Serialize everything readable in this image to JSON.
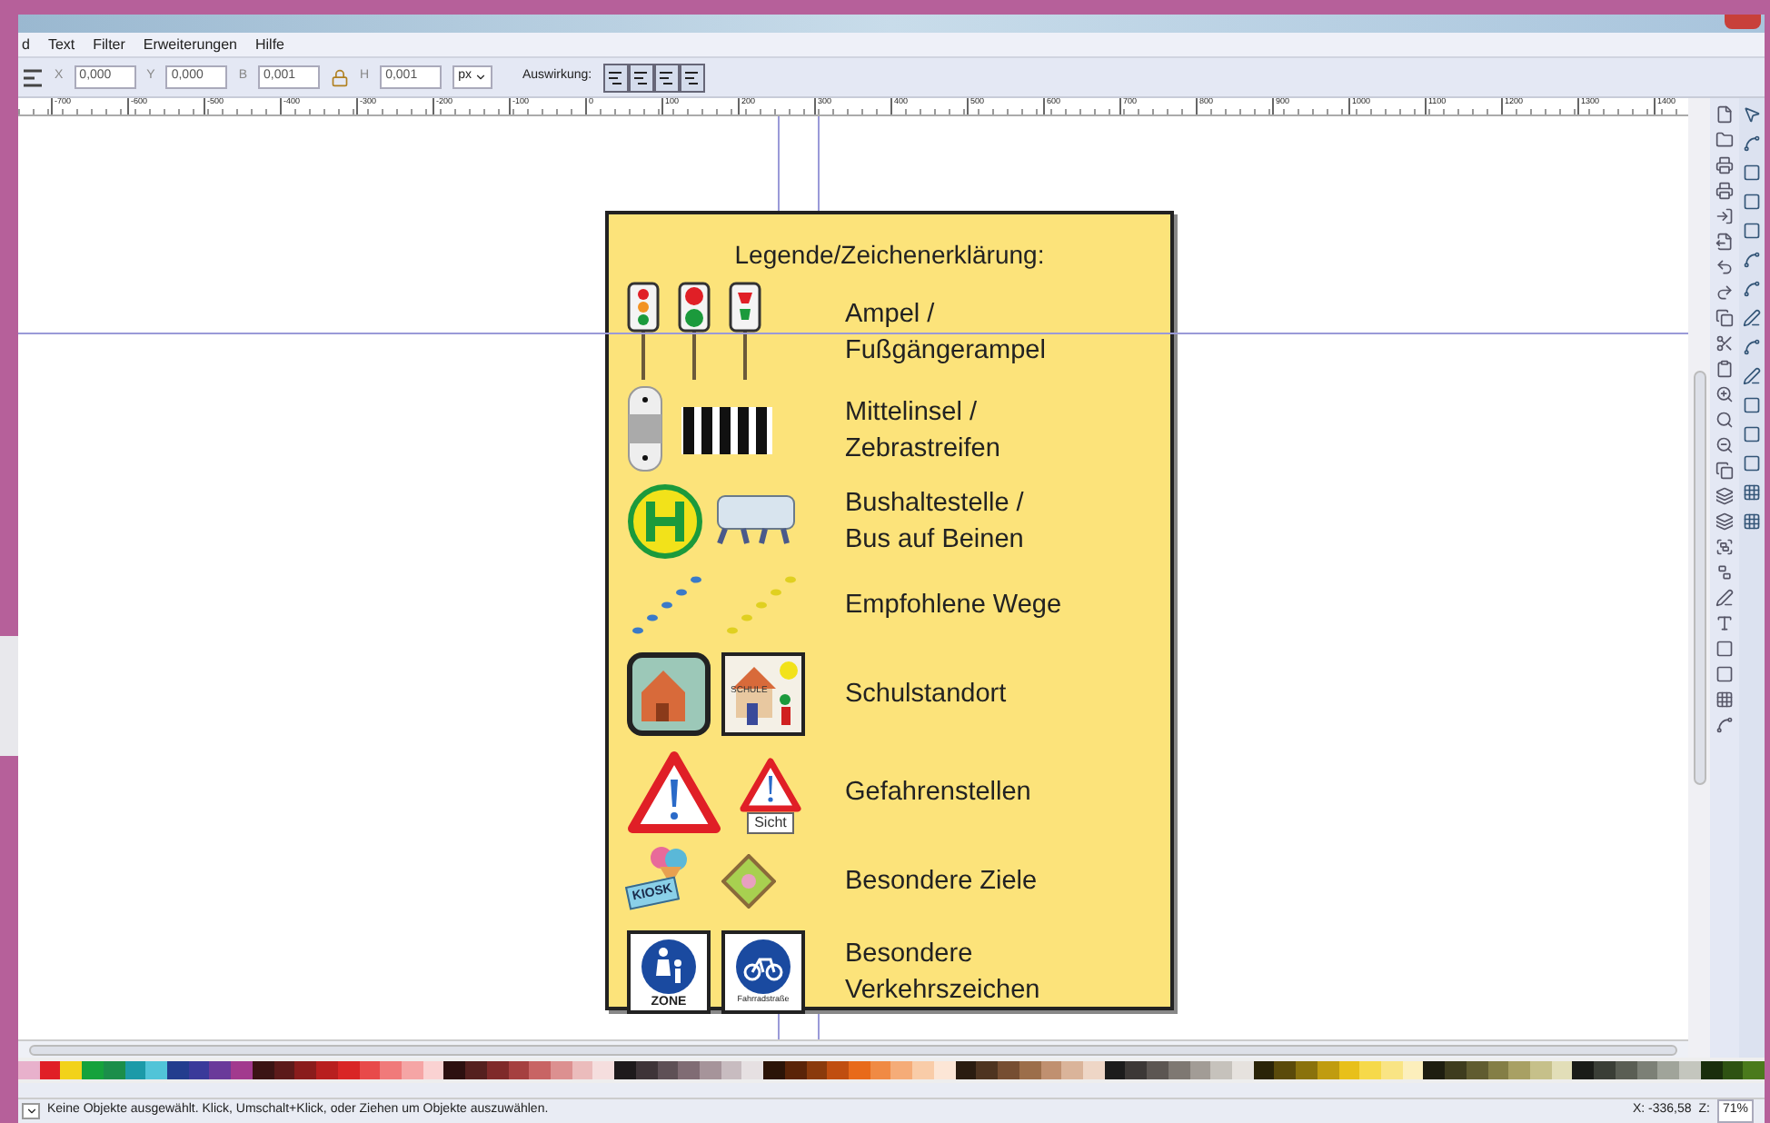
{
  "menu": [
    "d",
    "Text",
    "Filter",
    "Erweiterungen",
    "Hilfe"
  ],
  "toolbar": {
    "fields": [
      {
        "label": "X",
        "value": "0,000"
      },
      {
        "label": "Y",
        "value": "0,000"
      },
      {
        "label": "B",
        "value": "0,001"
      },
      {
        "label": "H",
        "value": "0,001"
      }
    ],
    "unit": "px",
    "effect_label": "Auswirkung:"
  },
  "ruler": [
    "-700",
    "-600",
    "-500",
    "-400",
    "-300",
    "-200",
    "-100",
    "0",
    "100",
    "200",
    "300",
    "400",
    "500",
    "600",
    "700",
    "800",
    "900",
    "1000",
    "1100",
    "1200",
    "1300",
    "1400"
  ],
  "legend": {
    "title": "Legende/Zeichenerklärung:",
    "rows": [
      {
        "kind": "lights",
        "text": "Ampel /\nFußgängerampel"
      },
      {
        "kind": "crossing",
        "text": "Mittelinsel /\nZebrastreifen"
      },
      {
        "kind": "bus",
        "text": "Bushaltestelle /\nBus auf Beinen"
      },
      {
        "kind": "steps",
        "text": "Empfohlene Wege"
      },
      {
        "kind": "school",
        "text": "Schulstandort",
        "sign_labels": [
          "SCHULE"
        ]
      },
      {
        "kind": "danger",
        "text": "Gefahrenstellen",
        "sign_labels": [
          "Sicht"
        ]
      },
      {
        "kind": "goals",
        "text": "Besondere Ziele",
        "sign_labels": [
          "KIOSK"
        ]
      },
      {
        "kind": "signs",
        "text": "Besondere\nVerkehrszeichen",
        "sign_labels": [
          "ZONE",
          "Fahrradstraße"
        ]
      }
    ]
  },
  "palette": [
    {
      "color": "#e8b1cc"
    },
    {
      "color": "#e01f26"
    },
    {
      "color": "#f2d21a"
    },
    {
      "color": "#15a23c"
    },
    {
      "color": "#1b8e4a"
    },
    {
      "color": "#1c9aa8"
    },
    {
      "color": "#51c4d8"
    },
    {
      "color": "#233d8e"
    },
    {
      "color": "#3a3a9a"
    },
    {
      "color": "#6a3a9a"
    },
    {
      "color": "#a23a8e"
    },
    {
      "color": "#3b1414"
    },
    {
      "color": "#5c1a1a"
    },
    {
      "color": "#8a1c1c"
    },
    {
      "color": "#b81f1f"
    },
    {
      "color": "#d92626"
    },
    {
      "color": "#e84a4a"
    },
    {
      "color": "#f07a7a"
    },
    {
      "color": "#f5a5a5"
    },
    {
      "color": "#fad2d2"
    },
    {
      "color": "#2d1010"
    },
    {
      "color": "#55201f"
    },
    {
      "color": "#7f2a2a"
    },
    {
      "color": "#a54040"
    },
    {
      "color": "#c86464"
    },
    {
      "color": "#dc9090"
    },
    {
      "color": "#ebbcbc"
    },
    {
      "color": "#f5dede"
    },
    {
      "color": "#1e1a1c"
    },
    {
      "color": "#3e3438"
    },
    {
      "color": "#5e5056"
    },
    {
      "color": "#806c74"
    },
    {
      "color": "#a6949a"
    },
    {
      "color": "#c8bcc0"
    },
    {
      "color": "#e6e0e2"
    },
    {
      "color": "#2b1408"
    },
    {
      "color": "#5a2408"
    },
    {
      "color": "#8a3a0c"
    },
    {
      "color": "#c04e10"
    },
    {
      "color": "#e86a1a"
    },
    {
      "color": "#f08a44"
    },
    {
      "color": "#f5ac78"
    },
    {
      "color": "#f9cca8"
    },
    {
      "color": "#fce6d6"
    },
    {
      "color": "#2a1c10"
    },
    {
      "color": "#4e3420"
    },
    {
      "color": "#764e32"
    },
    {
      "color": "#9c6e4a"
    },
    {
      "color": "#c09070"
    },
    {
      "color": "#dab49a"
    },
    {
      "color": "#eed6c6"
    },
    {
      "color": "#1c1c1c"
    },
    {
      "color": "#3c3836"
    },
    {
      "color": "#5c5652"
    },
    {
      "color": "#7e7872"
    },
    {
      "color": "#a29c96"
    },
    {
      "color": "#c6c2bc"
    },
    {
      "color": "#e6e2de"
    },
    {
      "color": "#2a2408"
    },
    {
      "color": "#5a4a0a"
    },
    {
      "color": "#8a720c"
    },
    {
      "color": "#c09c10"
    },
    {
      "color": "#e8c01a"
    },
    {
      "color": "#f6d94a"
    },
    {
      "color": "#f9e484"
    },
    {
      "color": "#fcefbc"
    },
    {
      "color": "#1e1e10"
    },
    {
      "color": "#3e3c1e"
    },
    {
      "color": "#605c30"
    },
    {
      "color": "#847e46"
    },
    {
      "color": "#a8a064"
    },
    {
      "color": "#c6c08a"
    },
    {
      "color": "#e2deb8"
    },
    {
      "color": "#1a1c18"
    },
    {
      "color": "#3a3e36"
    },
    {
      "color": "#5a5e54"
    },
    {
      "color": "#7c8076"
    },
    {
      "color": "#a0a49a"
    },
    {
      "color": "#c4c6be"
    },
    {
      "color": "#1a2e0c"
    },
    {
      "color": "#2e5212"
    },
    {
      "color": "#4a7a1c"
    }
  ],
  "status": {
    "message": "Keine Objekte ausgewählt. Klick, Umschalt+Klick, oder Ziehen um Objekte auszuwählen.",
    "coords": "X: -336,58",
    "zoom_label": "Z:",
    "zoom": "71%"
  }
}
